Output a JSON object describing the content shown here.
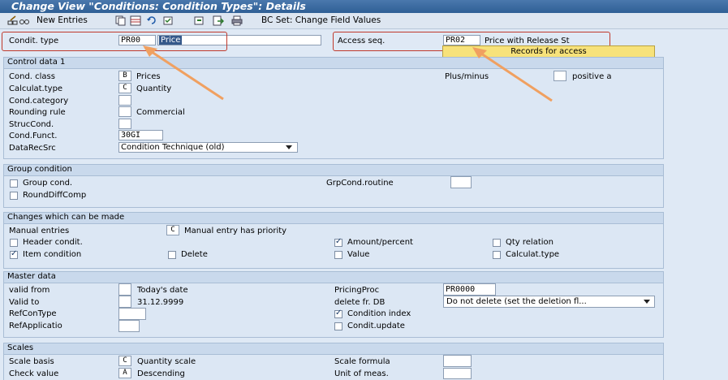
{
  "window": {
    "title": "Change View \"Conditions: Condition Types\": Details"
  },
  "toolbar": {
    "new_entries": "New Entries",
    "bc_set": "BC Set: Change Field Values"
  },
  "header": {
    "condit_type_label": "Condit. type",
    "condit_type_value": "PR00",
    "condit_type_desc": "Price",
    "access_seq_label": "Access seq.",
    "access_seq_value": "PR02",
    "access_seq_desc": "Price with Release St",
    "records_button": "Records for access"
  },
  "control": {
    "title": "Control data 1",
    "cond_class_label": "Cond. class",
    "cond_class_value": "B",
    "cond_class_desc": "Prices",
    "calc_type_label": "Calculat.type",
    "calc_type_value": "C",
    "calc_type_desc": "Quantity",
    "cond_category_label": "Cond.category",
    "rounding_label": "Rounding rule",
    "rounding_desc": "Commercial",
    "struc_label": "StrucCond.",
    "funct_label": "Cond.Funct.",
    "funct_value": "30GI",
    "datarec_label": "DataRecSrc",
    "datarec_value": "Condition Technique (old)",
    "plusminus_label": "Plus/minus",
    "positive_label": "positive a"
  },
  "group": {
    "title": "Group condition",
    "group_cond": "Group cond.",
    "round_diff": "RoundDiffComp",
    "routine_label": "GrpCond.routine"
  },
  "changes": {
    "title": "Changes which can be made",
    "manual_label": "Manual entries",
    "manual_value": "C",
    "manual_desc": "Manual entry has priority",
    "header_cond": "Header condit.",
    "amount_percent": "Amount/percent",
    "qty_relation": "Qty relation",
    "item_cond": "Item condition",
    "delete": "Delete",
    "value": "Value",
    "calc_type": "Calculat.type"
  },
  "master": {
    "title": "Master data",
    "valid_from_label": "valid from",
    "valid_from_desc": "Today's date",
    "valid_to_label": "Valid to",
    "valid_to_desc": "31.12.9999",
    "refcon_label": "RefConType",
    "refapp_label": "RefApplicatio",
    "pricing_label": "PricingProc",
    "pricing_value": "PR0000",
    "delete_label": "delete fr. DB",
    "delete_value": "Do not delete (set the deletion fl...",
    "cond_index": "Condition index",
    "cond_update": "Condit.update"
  },
  "scales": {
    "title": "Scales",
    "basis_label": "Scale basis",
    "basis_value": "C",
    "basis_desc": "Quantity scale",
    "check_label": "Check value",
    "check_value": "A",
    "check_desc": "Descending",
    "formula_label": "Scale formula",
    "unit_label": "Unit of meas."
  },
  "colors": {
    "annotation_arrow": "#f0a060",
    "annotation_box": "#c0392b",
    "title_bar": "#2f5f95",
    "records_button": "#f7e27a"
  },
  "checkbox_states": {
    "group_cond": false,
    "round_diff": false,
    "header_cond": false,
    "amount_percent": true,
    "qty_relation": false,
    "item_cond": true,
    "delete": false,
    "value": false,
    "calc_type": false,
    "cond_index": true,
    "cond_update": false,
    "positive": false
  }
}
